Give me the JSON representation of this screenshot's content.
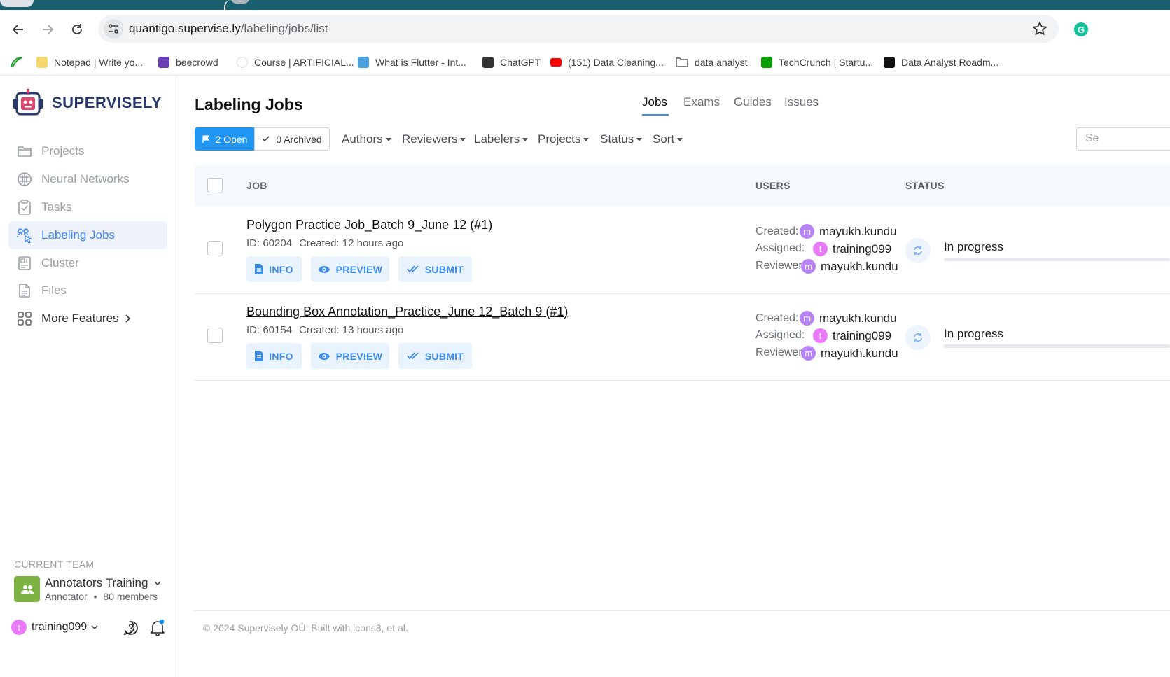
{
  "browser": {
    "url_host": "quantigo.supervise.ly",
    "url_path": "/labeling/jobs/list",
    "bookmarks": [
      {
        "label": "Notepad | Write yo...",
        "icon": "notepad-icon",
        "color": "#f5d76e"
      },
      {
        "label": "beecrowd",
        "icon": "beecrowd-icon",
        "color": "#6a3fb5"
      },
      {
        "label": "Course | ARTIFICIAL...",
        "icon": "globe-icon",
        "color": "#dadce0"
      },
      {
        "label": "What is Flutter - Int...",
        "icon": "site-icon",
        "color": "#4aa3df"
      },
      {
        "label": "ChatGPT",
        "icon": "chatgpt-icon",
        "color": "#333333"
      },
      {
        "label": "(151) Data Cleaning...",
        "icon": "youtube-icon",
        "color": "#ff0000"
      },
      {
        "label": "data analyst",
        "icon": "folder-icon",
        "color": "#5f6368"
      },
      {
        "label": "TechCrunch | Startu...",
        "icon": "techcrunch-icon",
        "color": "#0a9e01"
      },
      {
        "label": "Data Analyst Roadm...",
        "icon": "roadmap-icon",
        "color": "#111111"
      }
    ]
  },
  "sidebar": {
    "brand": "SUPERVISELY",
    "items": [
      {
        "label": "Projects",
        "icon": "folder-icon"
      },
      {
        "label": "Neural Networks",
        "icon": "brain-icon"
      },
      {
        "label": "Tasks",
        "icon": "clipboard-icon"
      },
      {
        "label": "Labeling Jobs",
        "icon": "labeling-icon",
        "active": true
      },
      {
        "label": "Cluster",
        "icon": "cluster-icon"
      },
      {
        "label": "Files",
        "icon": "file-icon"
      },
      {
        "label": "More Features",
        "icon": "grid-icon"
      }
    ],
    "team_label": "CURRENT TEAM",
    "team_name": "Annotators Training",
    "team_role": "Annotator",
    "team_separator": "•",
    "team_members": "80 members",
    "user": "training099",
    "user_initial": "t"
  },
  "main": {
    "title": "Labeling Jobs",
    "tabs": [
      "Jobs",
      "Exams",
      "Guides",
      "Issues"
    ],
    "filters": {
      "open": "2 Open",
      "archived": "0 Archived",
      "dropdowns": [
        "Authors",
        "Reviewers",
        "Labelers",
        "Projects",
        "Status",
        "Sort"
      ],
      "search_placeholder": "Se"
    },
    "columns": {
      "job": "JOB",
      "users": "USERS",
      "status": "STATUS"
    },
    "actions": {
      "info": "INFO",
      "preview": "PREVIEW",
      "submit": "SUBMIT"
    },
    "user_labels": {
      "created": "Created:",
      "assigned": "Assigned:",
      "reviewer": "Reviewer:"
    },
    "jobs": [
      {
        "title": "Polygon Practice Job_Batch 9_June 12 (#1)",
        "id": "ID: 60204",
        "created": "Created: 12 hours ago",
        "created_by": "mayukh.kundu",
        "created_by_initial": "m",
        "assigned": "training099",
        "assigned_initial": "t",
        "reviewer": "mayukh.kundu",
        "reviewer_initial": "m",
        "status": "In progress",
        "progress": 0.0
      },
      {
        "title": "Bounding Box Annotation_Practice_June 12_Batch 9 (#1)",
        "id": "ID: 60154",
        "created": "Created: 13 hours ago",
        "created_by": "mayukh.kundu",
        "created_by_initial": "m",
        "assigned": "training099",
        "assigned_initial": "t",
        "reviewer": "mayukh.kundu",
        "reviewer_initial": "m",
        "status": "In progress",
        "progress": 0.0
      }
    ]
  },
  "footer": "© 2024 Supervisely OÜ. Built with icons8, et al.",
  "colors": {
    "accent": "#3f86f7",
    "primary_button": "#2196f3",
    "team_avatar": "#7cb342"
  }
}
